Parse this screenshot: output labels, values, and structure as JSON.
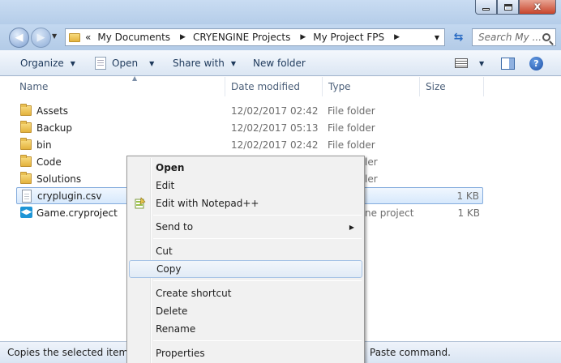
{
  "window": {
    "buttons": {
      "minimize": "–",
      "maximize": "□",
      "close": "x"
    }
  },
  "nav": {
    "back_glyph": "◀",
    "forward_glyph": "▶",
    "history_dropdown": "▼"
  },
  "address": {
    "overflow": "«",
    "crumbs": [
      "My Documents",
      "CRYENGINE Projects",
      "My Project FPS"
    ],
    "separator": "▶",
    "dropdown": "▼",
    "refresh_glyph": "⇆"
  },
  "search": {
    "placeholder": "Search My ..."
  },
  "toolbar": {
    "organize": "Organize",
    "open": "Open",
    "share_with": "Share with",
    "new_folder": "New folder",
    "caret": "▼",
    "help": "?"
  },
  "columns": {
    "name": "Name",
    "date_modified": "Date modified",
    "type": "Type",
    "size": "Size",
    "sort_indicator": "▲"
  },
  "files": [
    {
      "name": "Assets",
      "date": "12/02/2017 02:42",
      "type": "File folder",
      "size": "",
      "icon": "folder-icon"
    },
    {
      "name": "Backup",
      "date": "12/02/2017 05:13",
      "type": "File folder",
      "size": "",
      "icon": "folder-icon"
    },
    {
      "name": "bin",
      "date": "12/02/2017 02:42",
      "type": "File folder",
      "size": "",
      "icon": "folder-icon"
    },
    {
      "name": "Code",
      "date": "",
      "type": "ler",
      "size": "",
      "icon": "folder-icon"
    },
    {
      "name": "Solutions",
      "date": "",
      "type": "ler",
      "size": "",
      "icon": "folder-icon"
    },
    {
      "name": "cryplugin.csv",
      "date": "",
      "type": "",
      "size": "1 KB",
      "icon": "file-icon",
      "selected": true
    },
    {
      "name": "Game.cryproject",
      "date": "",
      "type": "ne project",
      "size": "1 KB",
      "icon": "cryproject-icon"
    }
  ],
  "status": {
    "left": "Copies the selected items to",
    "right": "Paste command."
  },
  "context_menu": {
    "items": [
      {
        "label": "Open",
        "bold": true
      },
      {
        "label": "Edit"
      },
      {
        "label": "Edit with Notepad++",
        "icon": "notepad-plus-plus-icon"
      },
      {
        "label": "Send to",
        "submenu": "▶"
      },
      {
        "label": "Cut"
      },
      {
        "label": "Copy",
        "highlighted": true
      },
      {
        "label": "Create shortcut"
      },
      {
        "label": "Delete"
      },
      {
        "label": "Rename"
      },
      {
        "label": "Properties"
      }
    ]
  }
}
